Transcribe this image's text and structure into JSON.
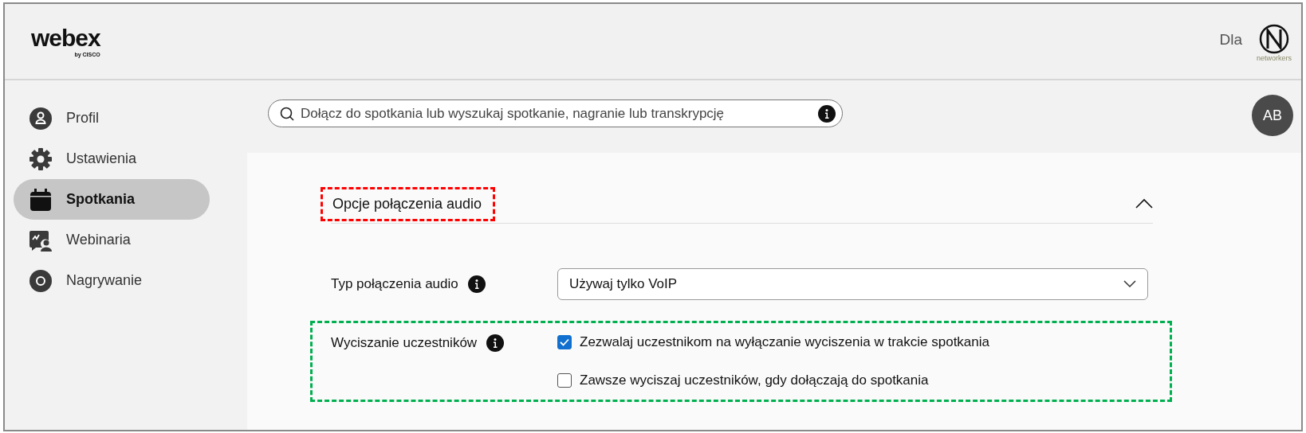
{
  "header": {
    "logo": "webex",
    "logo_sub": "by CISCO",
    "user_label": "Dla",
    "org_logo_text": "networkers"
  },
  "sidebar": {
    "items": [
      {
        "label": "Profil",
        "selected": false
      },
      {
        "label": "Ustawienia",
        "selected": false
      },
      {
        "label": "Spotkania",
        "selected": true
      },
      {
        "label": "Webinaria",
        "selected": false
      },
      {
        "label": "Nagrywanie",
        "selected": false
      }
    ]
  },
  "search": {
    "placeholder": "Dołącz do spotkania lub wyszukaj spotkanie, nagranie lub transkrypcję"
  },
  "avatar": {
    "initials": "AB"
  },
  "section": {
    "title": "Opcje połączenia audio",
    "expanded": true,
    "fields": [
      {
        "kind": "select",
        "label": "Typ połączenia audio",
        "value": "Używaj tylko VoIP"
      },
      {
        "kind": "checkboxes",
        "label": "Wyciszanie uczestników",
        "options": [
          {
            "label": "Zezwalaj uczestnikom na wyłączanie wyciszenia w trakcie spotkania",
            "checked": true
          },
          {
            "label": "Zawsze wyciszaj uczestników, gdy dołączają do spotkania",
            "checked": false
          }
        ]
      }
    ]
  }
}
